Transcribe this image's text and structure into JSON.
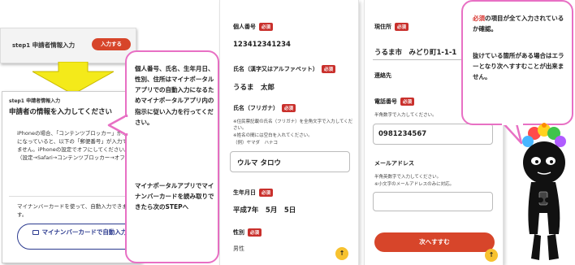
{
  "panel1_top": {
    "step_prefix": "step1",
    "step_title": "申請者情報入力",
    "button": "入力する"
  },
  "panel1": {
    "sub": "step1 申請者情報入力",
    "title": "申請者の情報を入力してください",
    "note": "iPhoneの場合、「コンテンツブロッカー」がオンになっていると、以下の「郵便番号」が入力できません。iPhoneの設定でオフにしてください。（設定→Safari→コンテンツブロッカー→オフ）",
    "desc": "マイナンバーカードを使って、自動入力できます。",
    "mynumber_button": "マイナンバーカードで自動入力"
  },
  "bubble1": {
    "text1": "個人番号、氏名、生年月日、性別、住所はマイナポータルアプリでの自動入力になるためマイナポータルアプリ内の指示に従い入力を行ってください。",
    "text2": "マイナポータルアプリでマイナンバーカードを読み取りできたら次のSTEPへ"
  },
  "panel2": {
    "required_badge": "必須",
    "mynumber_label": "個人番号",
    "mynumber_value": "123412341234",
    "name_label": "氏名（漢字又はアルファベット）",
    "name_value": "うるま　太郎",
    "kana_label": "氏名（フリガナ）",
    "kana_hint1": "※住民票記載の氏名（フリガナ）を全角文字で入力してください。",
    "kana_hint2": "※姓名の間には空白を入れてください。",
    "kana_hint3": "（例）ヤマダ　ハナコ",
    "kana_value": "ウルマ タロウ",
    "birth_label": "生年月日",
    "birth_value": "平成7年　5月　5日",
    "gender_label": "性別",
    "gender_value": "男性",
    "up_arrow": "↑"
  },
  "panel3": {
    "required_badge": "必須",
    "address_label": "現住所",
    "address_value": "うるま市　みどり町1-1-1",
    "contact_label": "連絡先",
    "phone_label": "電話番号",
    "phone_hint": "半角数字で入力してください。",
    "phone_value": "0981234567",
    "email_label": "メールアドレス",
    "email_hint1": "半角英数字で入力してください。",
    "email_hint2": "※小文字のメールアドレスのみに対応。",
    "next_button": "次へすすむ",
    "up_arrow": "↑"
  },
  "bubble2": {
    "text1_red": "必須",
    "text1_rest": "の項目が全て入力されているか確認。",
    "text2": "抜けている箇所がある場合はエラーとなり次へすすむことが出来ません。"
  },
  "colors": {
    "accent_red": "#d7452a",
    "bubble_pink": "#e870c4",
    "navy": "#2b3a8f",
    "arrow_yellow": "#f4ea1a"
  }
}
